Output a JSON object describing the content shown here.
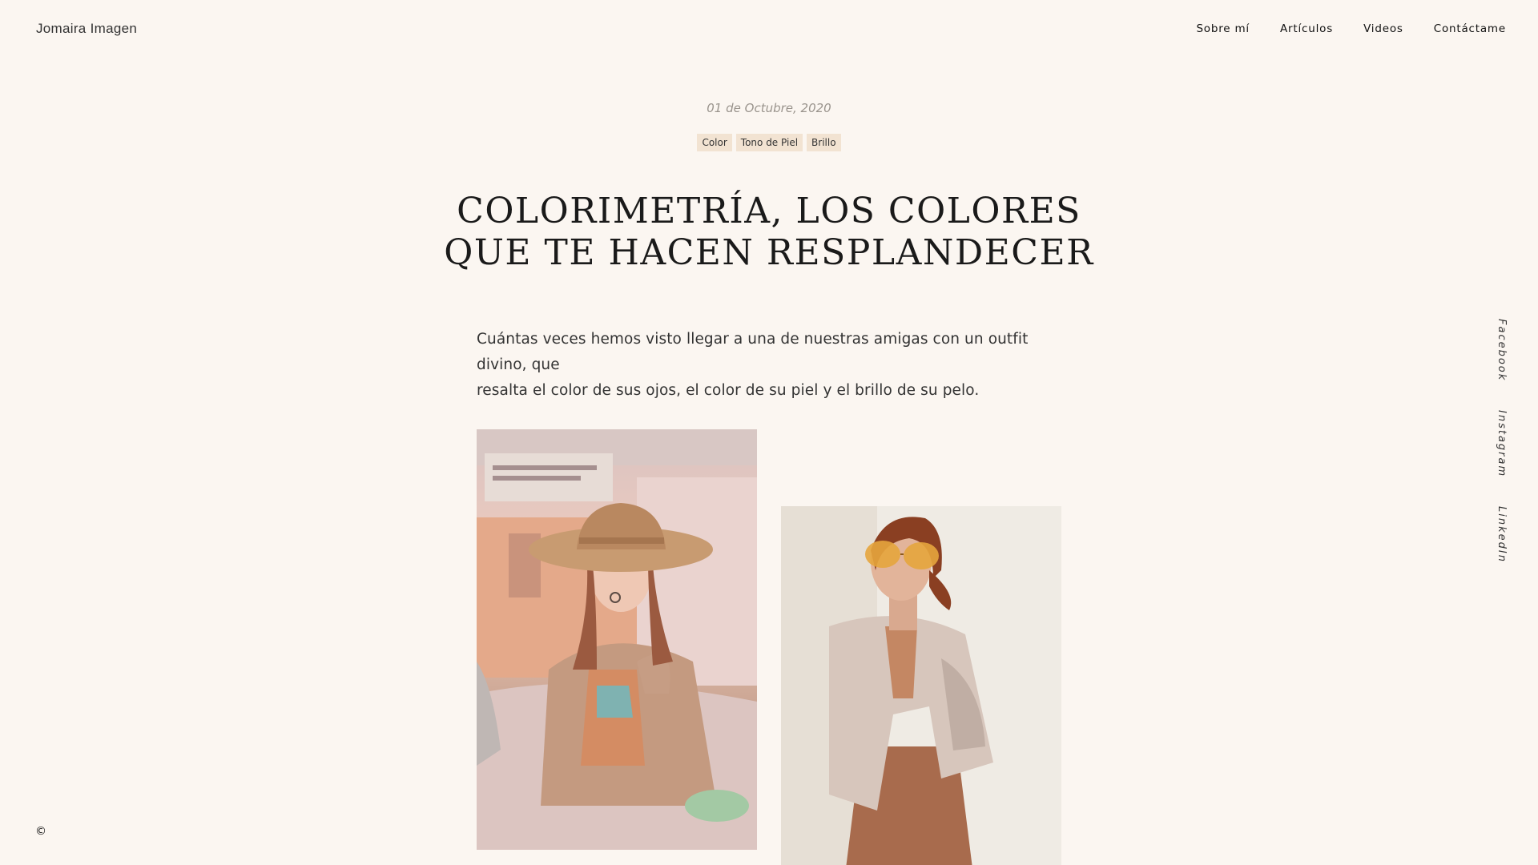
{
  "header": {
    "brand": "Jomaira Imagen",
    "nav": [
      "Sobre mí",
      "Artículos",
      "Videos",
      "Contáctame"
    ]
  },
  "article": {
    "date": "01 de Octubre, 2020",
    "tags": [
      "Color",
      "Tono de Piel",
      "Brillo"
    ],
    "title_lines": [
      "COLORIMETRÍA, LOS COLORES",
      "QUE TE HACEN RESPLANDECER"
    ],
    "lead_lines": [
      "Cuántas veces hemos visto llegar a una de nuestras amigas con un outfit divino, que",
      "resalta el color de sus ojos, el color de su piel y el brillo de su pelo."
    ]
  },
  "social": [
    "Facebook",
    "Instagram",
    "LinkedIn"
  ],
  "footer": {
    "copyright": "©"
  },
  "colors": {
    "background": "#fbf6f1",
    "tag_background": "#f2e3d2",
    "date_text": "#9a948d",
    "title_text": "#1a1a1a"
  }
}
